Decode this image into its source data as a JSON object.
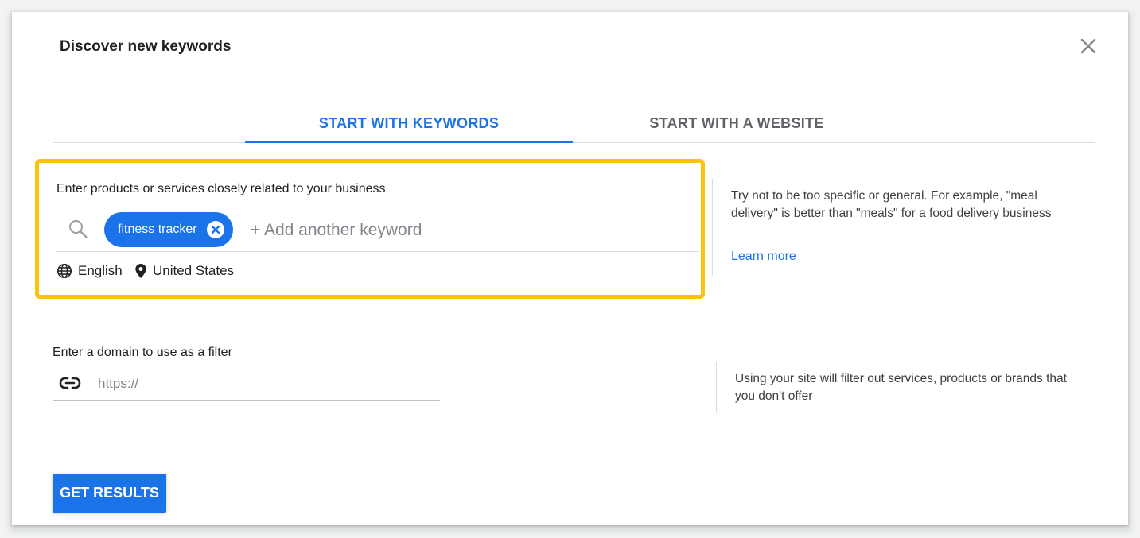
{
  "dialog": {
    "title": "Discover new keywords",
    "close_icon": "close-icon"
  },
  "tabs": [
    {
      "label": "START WITH KEYWORDS",
      "active": true
    },
    {
      "label": "START WITH A WEBSITE",
      "active": false
    }
  ],
  "keywords_section": {
    "label": "Enter products or services closely related to your business",
    "search_icon": "search-icon",
    "chips": [
      {
        "label": "fitness tracker",
        "remove_icon": "close-circle-icon"
      }
    ],
    "input_placeholder": "+ Add another keyword",
    "input_value": "",
    "language": {
      "icon": "globe-icon",
      "label": "English"
    },
    "location": {
      "icon": "location-pin-icon",
      "label": "United States"
    },
    "highlight_color": "#fbc30c"
  },
  "keywords_help": {
    "text": "Try not to be too specific or general. For example, \"meal delivery\" is better than \"meals\" for a food delivery business",
    "link_label": "Learn more"
  },
  "domain_section": {
    "label": "Enter a domain to use as a filter",
    "link_icon": "link-icon",
    "input_placeholder": "https://",
    "input_value": ""
  },
  "domain_help": {
    "text": "Using your site will filter out services, products or brands that you don't offer"
  },
  "actions": {
    "get_results_label": "GET RESULTS"
  },
  "colors": {
    "accent": "#1a73e8",
    "highlight": "#fbc30c",
    "text_primary": "#202124",
    "text_secondary": "#5f6368"
  }
}
